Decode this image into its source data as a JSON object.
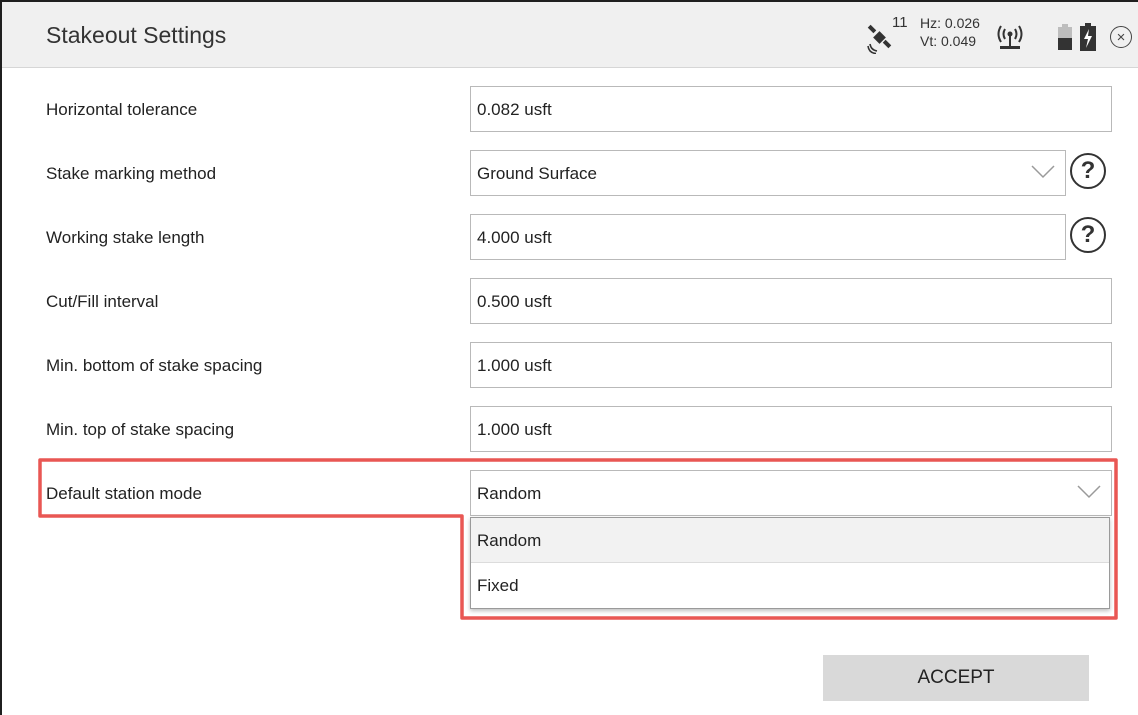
{
  "header": {
    "title": "Stakeout Settings",
    "satellites": "11",
    "hz": "Hz: 0.026",
    "vt": "Vt: 0.049",
    "icons": [
      "satellite-icon",
      "radio-icon",
      "battery-icon",
      "charging-icon",
      "close-icon"
    ]
  },
  "settings": {
    "horizontal_tolerance": {
      "label": "Horizontal tolerance",
      "value": "0.082 usft"
    },
    "stake_marking_method": {
      "label": "Stake marking method",
      "value": "Ground Surface"
    },
    "working_stake_length": {
      "label": "Working stake length",
      "value": "4.000 usft"
    },
    "cut_fill_interval": {
      "label": "Cut/Fill interval",
      "value": "0.500 usft"
    },
    "min_bottom_spacing": {
      "label": "Min. bottom of stake spacing",
      "value": "1.000 usft"
    },
    "min_top_spacing": {
      "label": "Min. top of stake spacing",
      "value": "1.000 usft"
    },
    "default_station_mode": {
      "label": "Default station mode",
      "value": "Random",
      "options": [
        "Random",
        "Fixed"
      ]
    }
  },
  "help_glyph": "?",
  "close_glyph": "×",
  "accept_label": "ACCEPT",
  "colors": {
    "highlight": "#e53935",
    "titlebar": "#f0f0f0",
    "accept_button": "#d9d9d9"
  }
}
